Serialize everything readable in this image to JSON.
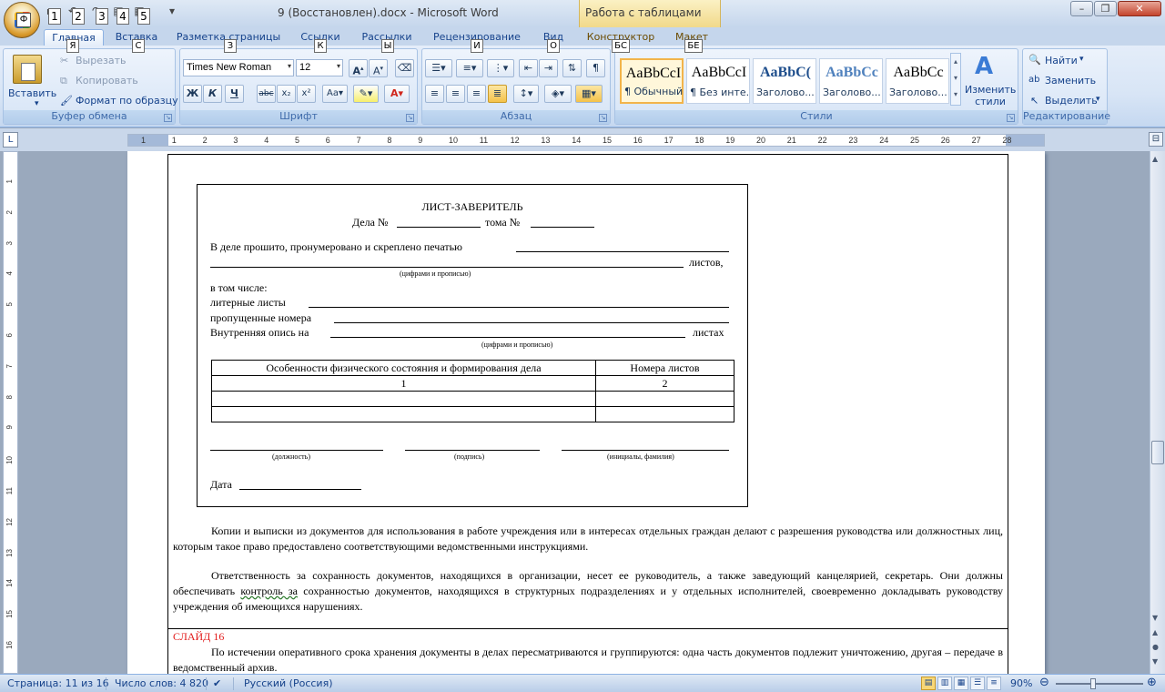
{
  "window": {
    "title": "9 (Восстановлен).docx - Microsoft Word",
    "context_tab_group": "Работа с таблицами",
    "office_key": "Ф",
    "qat_keys": [
      "1",
      "2",
      "3",
      "4",
      "5"
    ]
  },
  "tabs": [
    {
      "label": "Главная",
      "key": "Я"
    },
    {
      "label": "Вставка",
      "key": "С"
    },
    {
      "label": "Разметка страницы",
      "key": "З"
    },
    {
      "label": "Ссылки",
      "key": "К"
    },
    {
      "label": "Рассылки",
      "key": "Ы"
    },
    {
      "label": "Рецензирование",
      "key": "И"
    },
    {
      "label": "Вид",
      "key": "О"
    },
    {
      "label": "Конструктор",
      "key": "БС"
    },
    {
      "label": "Макет",
      "key": "БЕ"
    }
  ],
  "ribbon": {
    "clipboard": {
      "label": "Буфер обмена",
      "paste": "Вставить",
      "cut": "Вырезать",
      "copy": "Копировать",
      "format_painter": "Формат по образцу"
    },
    "font": {
      "label": "Шрифт",
      "font_name": "Times New Roman",
      "font_size": "12"
    },
    "paragraph": {
      "label": "Абзац"
    },
    "styles": {
      "label": "Стили",
      "items": [
        {
          "sample": "AaBbCcI",
          "name": "¶ Обычный"
        },
        {
          "sample": "AaBbCcI",
          "name": "¶ Без инте..."
        },
        {
          "sample": "AaBbC(",
          "name": "Заголово..."
        },
        {
          "sample": "AaBbCc",
          "name": "Заголово..."
        },
        {
          "sample": "AaBbCc",
          "name": "Заголово..."
        }
      ],
      "change": "Изменить стили"
    },
    "editing": {
      "label": "Редактирование",
      "find": "Найти",
      "replace": "Заменить",
      "select": "Выделить"
    }
  },
  "ruler": {
    "h_numbers": [
      "1",
      "1",
      "2",
      "3",
      "4",
      "5",
      "6",
      "7",
      "8",
      "9",
      "10",
      "11",
      "12",
      "13",
      "14",
      "15",
      "16",
      "17",
      "18",
      "19",
      "20",
      "21",
      "22",
      "23",
      "24",
      "25",
      "26",
      "27",
      "28"
    ],
    "v_numbers": [
      "1",
      "2",
      "3",
      "4",
      "5",
      "6",
      "7",
      "8",
      "9",
      "10",
      "11",
      "12",
      "13",
      "14",
      "15",
      "16"
    ]
  },
  "document": {
    "cert_title": "ЛИСТ-ЗАВЕРИТЕЛЬ",
    "cert_line2_a": "Дела №",
    "cert_line2_b": "тома №",
    "line_sewn": "В деле прошито, пронумеровано и скреплено печатью",
    "sheets": "листов,",
    "hint_digits": "(цифрами и прописью)",
    "including": "в том числе:",
    "letter_sheets": "литерные листы",
    "missing_numbers": "пропущенные номера",
    "inner_inventory": "Внутренняя опись на",
    "on_sheets": "листах",
    "hint_digits2": "(цифрами и прописью)",
    "table_headers": [
      "Особенности физического состояния и формирования дела",
      "Номера листов"
    ],
    "table_numbers": [
      "1",
      "2"
    ],
    "sig_position": "(должность)",
    "sig_signature": "(подпись)",
    "sig_name": "(инициалы, фамилия)",
    "date": "Дата",
    "para1": "Копии и выписки из документов для использования в работе учреждения или в интересах отдельных граждан делают с разрешения руководства или должностных лиц, которым такое право предоставлено соответствующими ведомственными инструкциями.",
    "para2_a": "Ответственность за сохранность документов, находящихся в организации, несет ее руководитель, а также заведующий канцелярией, секретарь. Они должны обеспечивать ",
    "para2_word": "контроль за",
    "para2_b": " сохранностью документов, находящихся в структурных подразделениях и у отдельных исполнителей, своевременно докладывать руководству учреждения об имеющихся нарушениях.",
    "slide_label": "СЛАЙД 16",
    "para3": "По истечении оперативного срока хранения документы в делах пересматриваются и группируются: одна часть документов подлежит уничтожению, другая – передаче в ведомственный архив."
  },
  "status": {
    "page": "Страница: 11 из 16",
    "words": "Число слов: 4 820",
    "language": "Русский (Россия)",
    "zoom": "90%"
  },
  "colors": {
    "accent": "#15428b",
    "slide_red": "#e21d1d"
  }
}
